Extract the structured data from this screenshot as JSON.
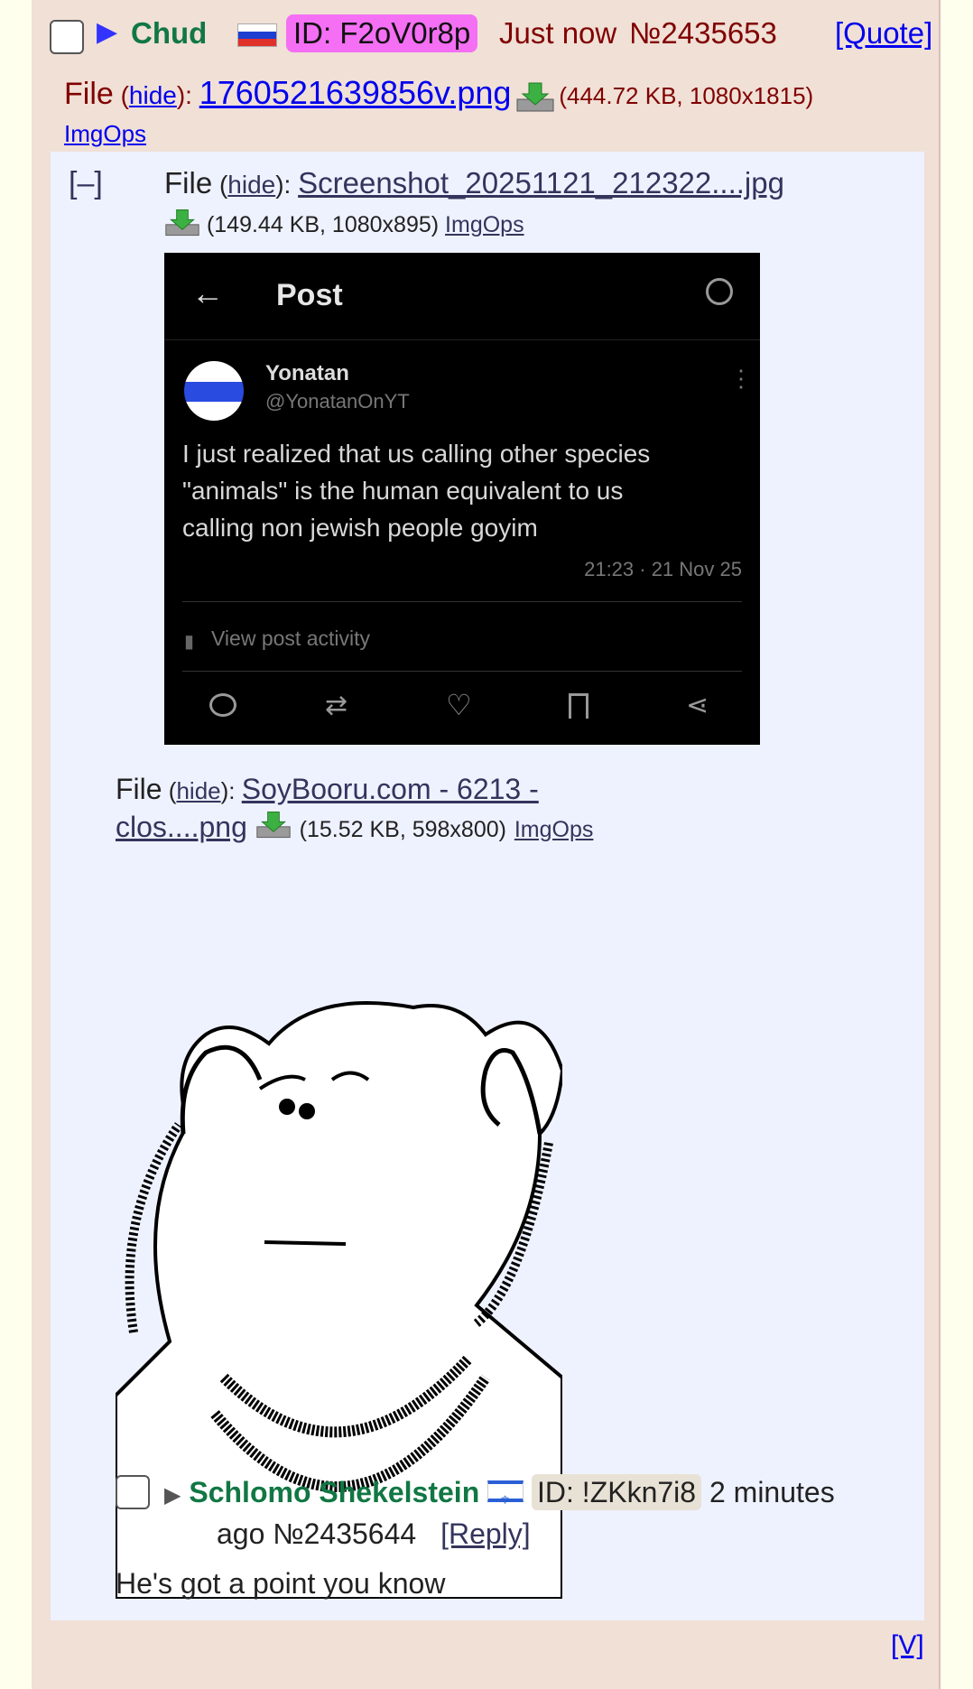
{
  "post": {
    "name": "Chud",
    "id": "ID: F2oV0r8p",
    "time": "Just now",
    "number": "№2435653",
    "quote_link": "[Quote]",
    "file_label": "File",
    "hide": "hide",
    "filename": "1760521639856v.png",
    "fileinfo": "(444.72 KB, 1080x1815)",
    "imgops": "ImgOps",
    "backlink": "[V]"
  },
  "embedded": {
    "collapse": "[–]",
    "file1": {
      "label": "File",
      "hide": "hide",
      "filename": "Screenshot_20251121_212322....jpg",
      "fileinfo": "(149.44 KB, 1080x895)",
      "imgops": "ImgOps"
    },
    "tweet": {
      "header": "Post",
      "display_name": "Yonatan",
      "handle": "@YonatanOnYT",
      "text_line1": "I just realized that us calling other species",
      "text_line2": "\"animals\" is the human equivalent to us",
      "text_line3": "calling non jewish people goyim",
      "timestamp": "21:23 · 21 Nov 25",
      "activity": "View post activity"
    },
    "file2": {
      "label": "File",
      "hide": "hide",
      "filename_line1": "SoyBooru.com - 6213 -",
      "filename_line2": "clos....png",
      "fileinfo": "(15.52 KB, 598x800)",
      "imgops": "ImgOps"
    },
    "reply": {
      "name": "Schlomo Shekelstein",
      "id": "ID: !ZKkn7i8",
      "time_part1": "2 minutes",
      "time_part2": "ago",
      "number": "№2435644",
      "reply_link": "[Reply]",
      "message": "He's got a point you know"
    }
  }
}
